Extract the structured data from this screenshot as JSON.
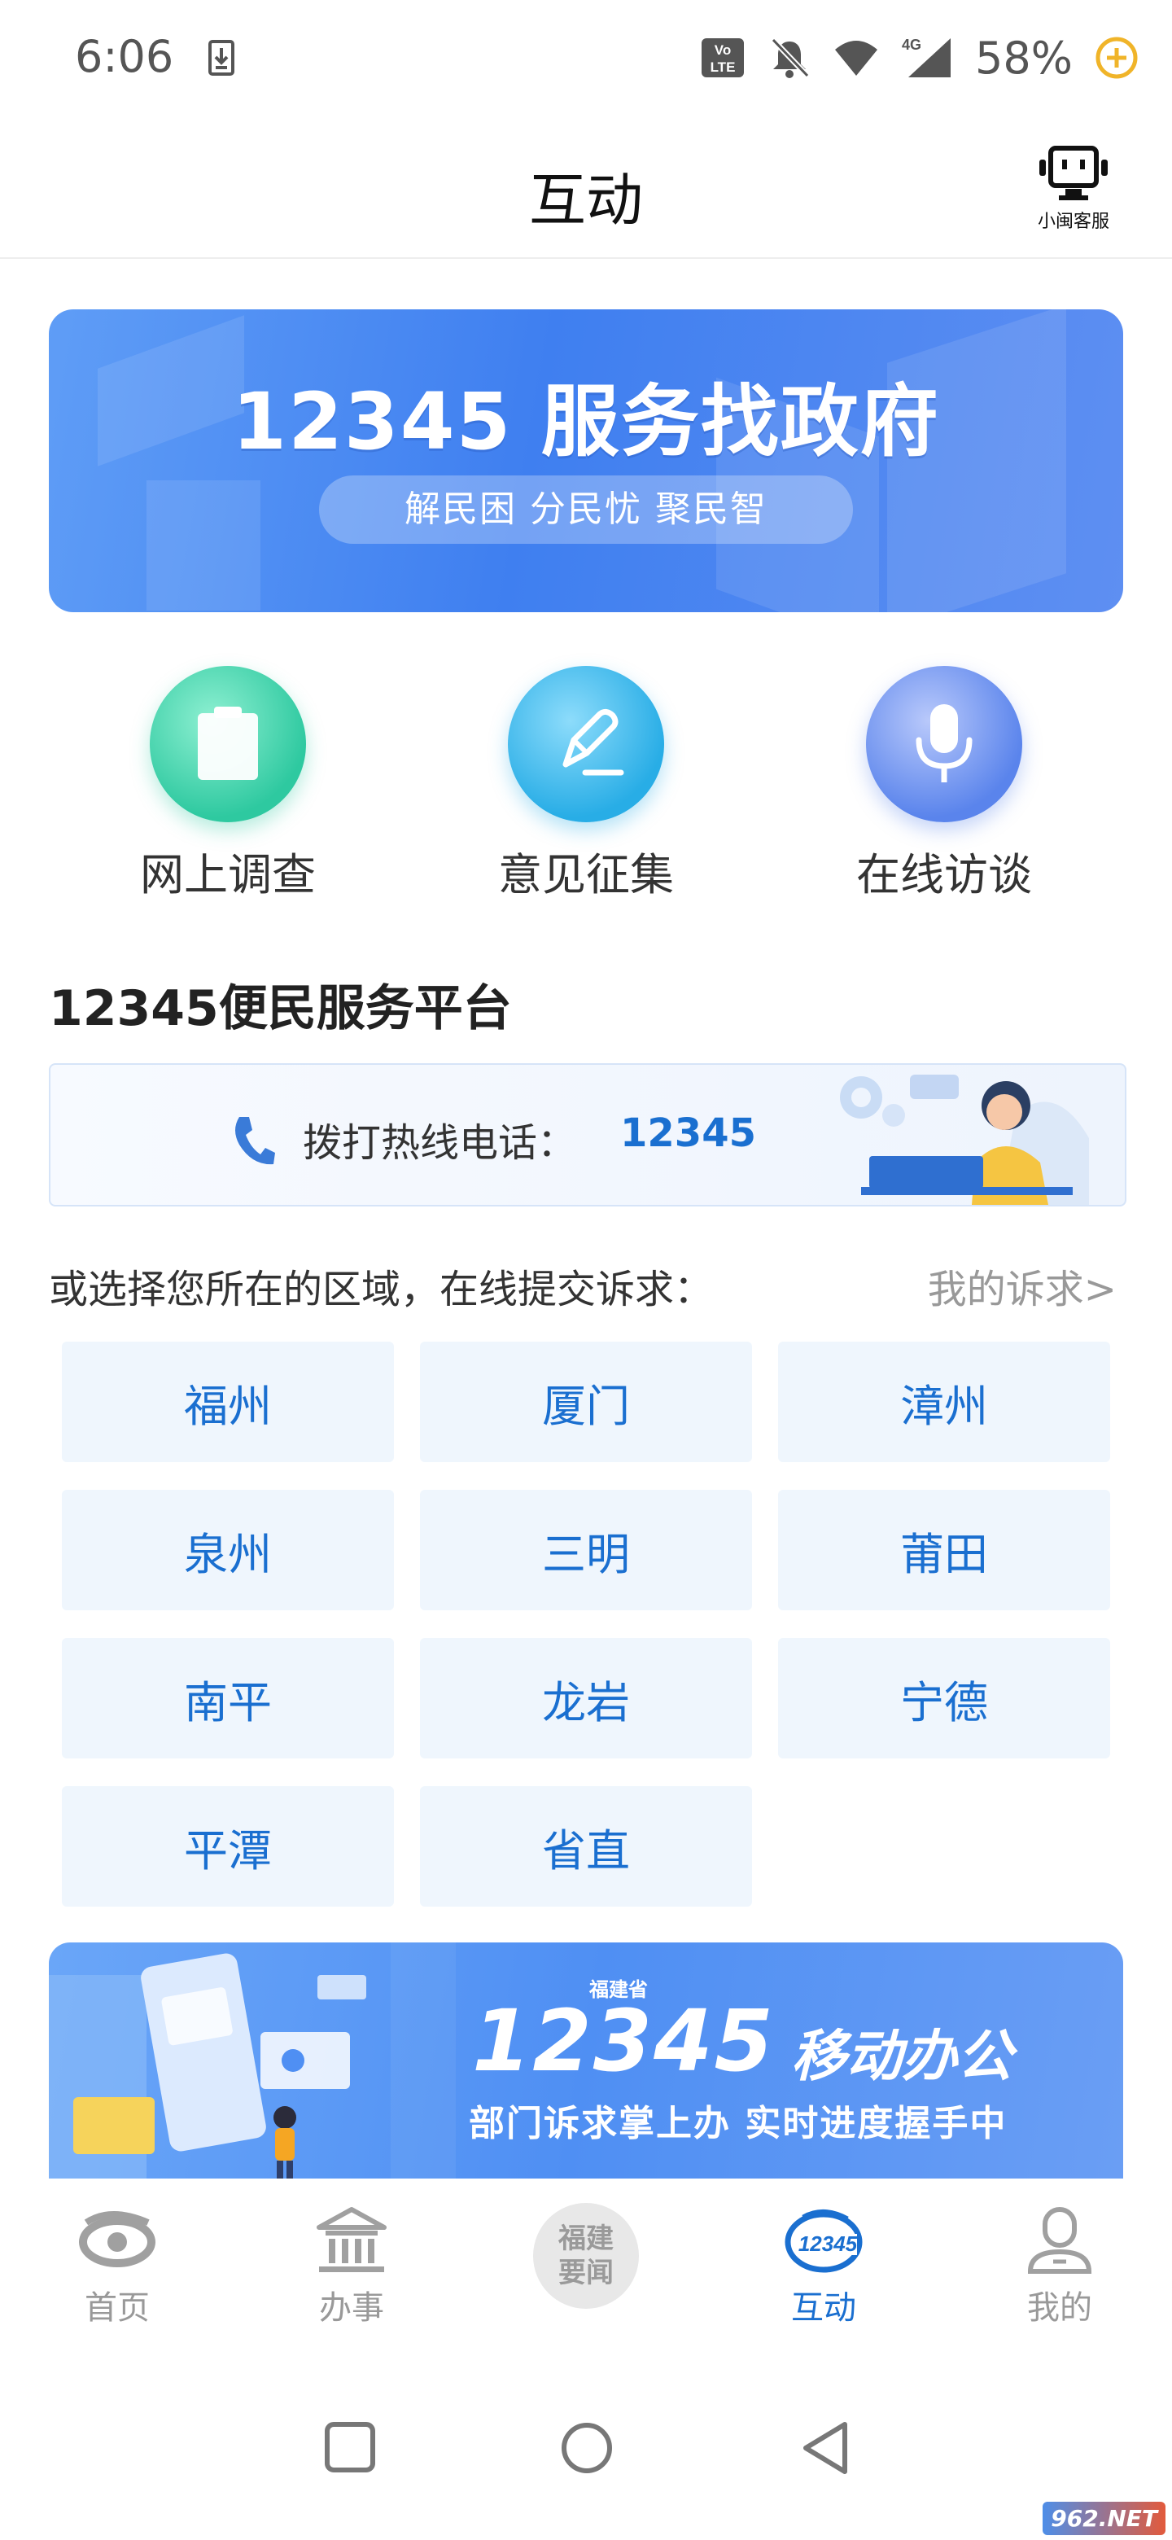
{
  "status_bar": {
    "time": "6:06",
    "battery": "58%",
    "network": "4G"
  },
  "header": {
    "title": "互动",
    "service_label": "小闽客服"
  },
  "top_banner": {
    "title": "12345 服务找政府",
    "slogan": "解民困  分民忧  聚民智"
  },
  "quick_actions": [
    {
      "label": "网上调查",
      "icon": "clipboard-icon",
      "color": "#35cfa6"
    },
    {
      "label": "意见征集",
      "icon": "pen-icon",
      "color": "#34b6e8"
    },
    {
      "label": "在线访谈",
      "icon": "microphone-icon",
      "color": "#5b88ee"
    }
  ],
  "platform": {
    "title": "12345便民服务平台",
    "hotline_label": "拨打热线电话：",
    "hotline_number": "12345"
  },
  "region_section": {
    "prompt": "或选择您所在的区域，在线提交诉求：",
    "my_appeals": "我的诉求>",
    "regions": [
      "福州",
      "厦门",
      "漳州",
      "泉州",
      "三明",
      "莆田",
      "南平",
      "龙岩",
      "宁德",
      "平潭",
      "省直"
    ]
  },
  "bottom_banner": {
    "province": "福建省",
    "number": "12345",
    "title": "移动办公",
    "slogan": "部门诉求掌上办  实时进度握手中"
  },
  "bottom_nav": {
    "items": [
      {
        "label": "首页",
        "icon": "home-eye-icon"
      },
      {
        "label": "办事",
        "icon": "government-building-icon"
      },
      {
        "label": "福建\n要闻",
        "icon": "news-circle-icon"
      },
      {
        "label": "互动",
        "icon": "12345-logo-icon"
      },
      {
        "label": "我的",
        "icon": "user-icon"
      }
    ],
    "active_index": 3,
    "news_line1": "福建",
    "news_line2": "要闻",
    "logo_text": "12345"
  },
  "watermark": "962.NET",
  "colors": {
    "accent": "#1a6fd0",
    "region_bg": "#eff6fd",
    "banner_blue": "#4a86f1"
  }
}
